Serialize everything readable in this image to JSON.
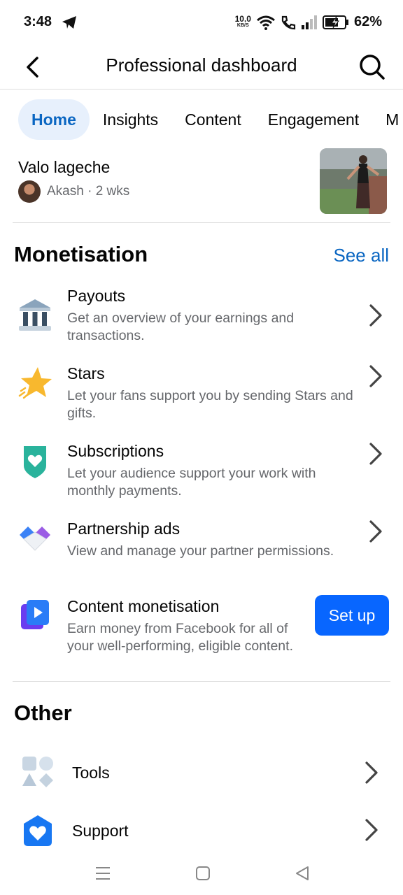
{
  "status_bar": {
    "time": "3:48",
    "speed_value": "10.0",
    "speed_unit": "KB/S",
    "battery": "62%"
  },
  "top_bar": {
    "title": "Professional dashboard"
  },
  "tabs": [
    {
      "label": "Home",
      "active": true
    },
    {
      "label": "Insights"
    },
    {
      "label": "Content"
    },
    {
      "label": "Engagement"
    },
    {
      "label": "M"
    }
  ],
  "post": {
    "title": "Valo lageche",
    "author": "Akash",
    "age": "2 wks",
    "meta": "Akash · 2 wks"
  },
  "monetisation": {
    "title": "Monetisation",
    "see_all": "See all",
    "items": [
      {
        "icon": "bank-icon",
        "title": "Payouts",
        "desc": "Get an overview of your earnings and transactions."
      },
      {
        "icon": "star-icon",
        "title": "Stars",
        "desc": "Let your fans support you by sending Stars and gifts."
      },
      {
        "icon": "heart-shield-icon",
        "title": "Subscriptions",
        "desc": "Let your audience support your work with monthly payments."
      },
      {
        "icon": "handshake-icon",
        "title": "Partnership ads",
        "desc": "View and manage your partner permissions."
      },
      {
        "icon": "video-play-icon",
        "title": "Content monetisation",
        "desc": "Earn money from Facebook for all of your well-performing, eligible content.",
        "button": "Set up"
      }
    ]
  },
  "other": {
    "title": "Other",
    "items": [
      {
        "icon": "tools-icon",
        "label": "Tools"
      },
      {
        "icon": "support-icon",
        "label": "Support"
      }
    ]
  },
  "colors": {
    "accent": "#0a66c2",
    "button": "#0866ff",
    "active_tab_bg": "#e7f0fc",
    "secondary_text": "#65676b"
  }
}
